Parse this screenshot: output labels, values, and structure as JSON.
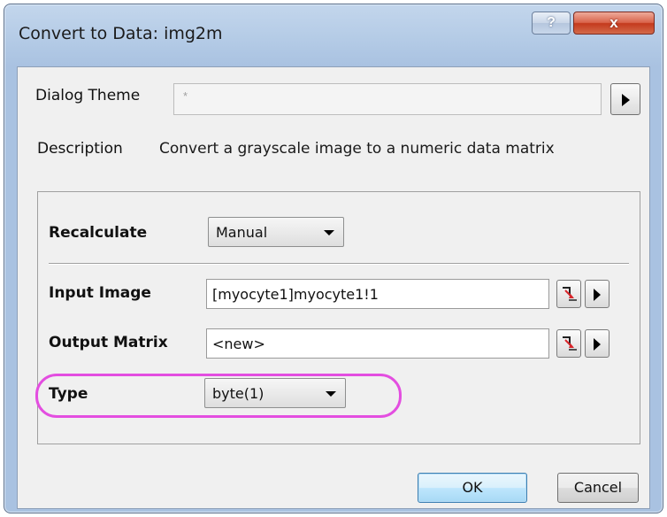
{
  "window": {
    "title": "Convert to Data: img2m",
    "help_label": "?",
    "close_label": "x"
  },
  "theme": {
    "label": "Dialog Theme",
    "value": "*"
  },
  "description": {
    "label": "Description",
    "value": "Convert a grayscale image to a numeric data matrix"
  },
  "recalculate": {
    "label": "Recalculate",
    "value": "Manual"
  },
  "input_image": {
    "label": "Input Image",
    "value": "[myocyte1]myocyte1!1"
  },
  "output_matrix": {
    "label": "Output Matrix",
    "value": "<new>"
  },
  "type": {
    "label": "Type",
    "value": "byte(1)"
  },
  "buttons": {
    "ok": "OK",
    "cancel": "Cancel"
  },
  "colors": {
    "highlight": "#e34ee0",
    "title_bar": "#b4cbe6",
    "close_button": "#c4391d"
  }
}
